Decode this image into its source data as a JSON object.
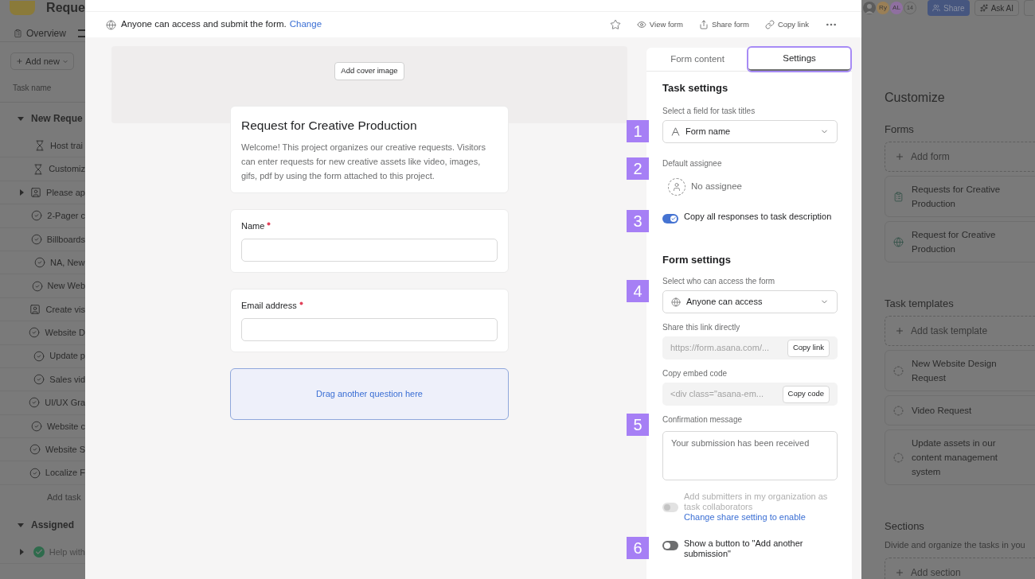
{
  "background": {
    "left": {
      "title": "Reque",
      "tab": "Overview",
      "add_button": "Add new",
      "column_header": "Task name",
      "sections": [
        {
          "name": "New Reque",
          "expanded": true,
          "tasks": [
            {
              "name": "Host trai",
              "kind": "milestone",
              "expandable": false
            },
            {
              "name": "Customiz",
              "kind": "milestone",
              "expandable": false
            },
            {
              "name": "Please ap",
              "kind": "approval",
              "expandable": true
            },
            {
              "name": "2-Pager c",
              "kind": "task",
              "expandable": false
            },
            {
              "name": "Billboards",
              "kind": "task",
              "expandable": false
            },
            {
              "name": "NA, New",
              "kind": "task",
              "expandable": false
            },
            {
              "name": "New Web",
              "kind": "task",
              "expandable": false
            },
            {
              "name": "Create vis",
              "kind": "approval",
              "expandable": false
            },
            {
              "name": "Website D",
              "kind": "task",
              "expandable": false
            },
            {
              "name": "Update p",
              "kind": "task",
              "expandable": false
            },
            {
              "name": "Sales vid",
              "kind": "task",
              "expandable": false
            },
            {
              "name": "UI/UX Gra",
              "kind": "task",
              "expandable": false
            },
            {
              "name": "Website c",
              "kind": "task",
              "expandable": false
            },
            {
              "name": "Website S",
              "kind": "task",
              "expandable": false
            },
            {
              "name": "Localize F",
              "kind": "task",
              "expandable": false
            }
          ],
          "add_task": "Add task"
        },
        {
          "name": "Assigned",
          "expanded": true,
          "tasks": [
            {
              "name": "Help with",
              "kind": "done",
              "expandable": true
            }
          ]
        }
      ]
    },
    "right": {
      "avatars": [
        {
          "kind": "photo"
        },
        {
          "kind": "initials",
          "label": "Ry",
          "color": "#9a7f56"
        },
        {
          "kind": "initials",
          "label": "AL",
          "color": "#8f6fa0"
        }
      ],
      "member_count": "14",
      "share_button": "Share",
      "ask_button": "Ask AI",
      "title": "Customize",
      "groups": [
        {
          "title": "Forms",
          "items": [
            {
              "kind": "add",
              "label": "Add form"
            },
            {
              "kind": "form",
              "label": "Requests for Creative Production"
            },
            {
              "kind": "public",
              "label": "Request for Creative Production"
            }
          ]
        },
        {
          "title": "Task templates",
          "items": [
            {
              "kind": "add",
              "label": "Add task template"
            },
            {
              "kind": "template",
              "label": "New Website Design Request"
            },
            {
              "kind": "template",
              "label": "Video Request"
            },
            {
              "kind": "template",
              "label": "Update assets in our content management system"
            }
          ]
        },
        {
          "title": "Sections",
          "description": "Divide and organize the tasks in you",
          "items": [
            {
              "kind": "add",
              "label": "Add section"
            }
          ]
        }
      ]
    }
  },
  "modal": {
    "access_bar": {
      "text": "Anyone can access and submit the form.",
      "link": "Change"
    },
    "toolbar": [
      {
        "kind": "star"
      },
      {
        "kind": "view",
        "label": "View form"
      },
      {
        "kind": "share",
        "label": "Share form"
      },
      {
        "kind": "link",
        "label": "Copy link"
      },
      {
        "kind": "more"
      }
    ],
    "cover_button": "Add cover image",
    "form": {
      "title": "Request for Creative Production",
      "description": "Welcome! This project organizes our creative requests. Visitors can enter requests for new creative assets like video, images, gifs, pdf by using the form attached to this project.",
      "questions": [
        {
          "label": "Name",
          "required": true
        },
        {
          "label": "Email address",
          "required": true
        }
      ],
      "drop_zone": "Drag another question here"
    },
    "panel": {
      "tabs": [
        {
          "label": "Form content",
          "selected": false,
          "highlighted": false
        },
        {
          "label": "Settings",
          "selected": true,
          "highlighted": true
        }
      ],
      "sections": [
        {
          "title": "Task settings",
          "items": [
            {
              "kind": "select",
              "label": "Select a field for task titles",
              "value": "Form name",
              "marker": "1"
            },
            {
              "kind": "assignee",
              "label": "Default assignee",
              "value": "No assignee",
              "marker": "2"
            },
            {
              "kind": "toggle",
              "label": "Copy all responses to task description",
              "on": true,
              "disabled": false,
              "marker": "3"
            }
          ]
        },
        {
          "title": "Form settings",
          "items": [
            {
              "kind": "select",
              "label": "Select who can access the form",
              "value": "Anyone can access",
              "marker": "4"
            },
            {
              "kind": "copy",
              "label": "Share this link directly",
              "value": "https://form.asana.com/...",
              "button": "Copy link"
            },
            {
              "kind": "copy",
              "label": "Copy embed code",
              "value": "<div class=\"asana-em...",
              "button": "Copy code"
            },
            {
              "kind": "textarea",
              "label": "Confirmation message",
              "placeholder": "Your submission has been received",
              "marker": "5"
            },
            {
              "kind": "toggle",
              "label": "Add submitters in my organization as task collaborators",
              "on": false,
              "disabled": true,
              "link": "Change share setting to enable"
            },
            {
              "kind": "toggle",
              "label": "Show a button to \"Add another submission\"",
              "on": false,
              "disabled": false,
              "marker": "6"
            }
          ]
        }
      ]
    }
  }
}
